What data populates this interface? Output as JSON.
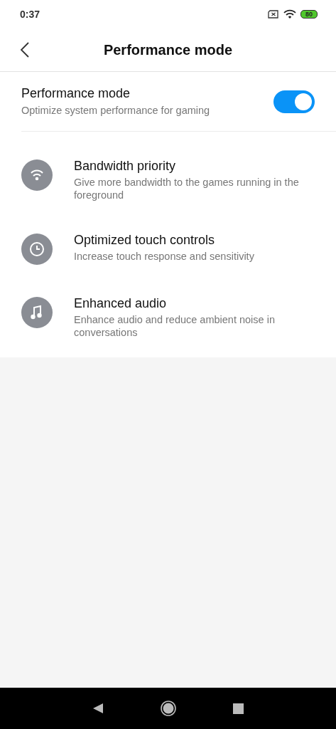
{
  "status_bar": {
    "time": "0:37",
    "battery": "80"
  },
  "header": {
    "title": "Performance mode"
  },
  "main_toggle": {
    "title": "Performance mode",
    "subtitle": "Optimize system performance for gaming",
    "on": true
  },
  "features": [
    {
      "kind": "wifi",
      "title": "Bandwidth priority",
      "subtitle": "Give more bandwidth to the games running in the foreground"
    },
    {
      "kind": "clock",
      "title": "Optimized touch controls",
      "subtitle": "Increase touch response and sensitivity"
    },
    {
      "kind": "music",
      "title": "Enhanced audio",
      "subtitle": "Enhance audio and reduce ambient noise in conversations"
    }
  ]
}
